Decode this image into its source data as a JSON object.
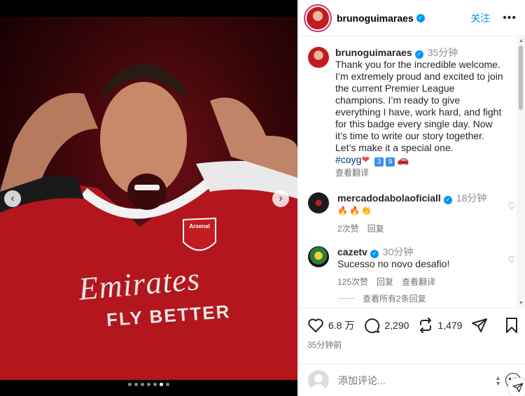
{
  "media": {
    "prev_icon": "chevron-left-icon",
    "next_icon": "chevron-right-icon",
    "slide_count": 7,
    "active_slide": 5,
    "jersey_brand": "Arsenal",
    "sponsor_line1": "Emirates",
    "sponsor_line2": "FLY BETTER"
  },
  "header": {
    "username": "brunoguimaraes",
    "follow_label": "关注",
    "more_icon": "more-horizontal-icon"
  },
  "caption": {
    "username": "brunoguimaraes",
    "time": "35分钟",
    "text": "Thank you for the incredible welcome. I’m extremely proud and excited to join the current Premier League champions. I’m ready to give everything I have, work hard, and fight for this badge every single day. Now it’s time to write our story together. Let’s make it a special one.",
    "hashtag": "#coyg",
    "heart": "❤",
    "key3": "3",
    "key9": "9",
    "car": "🚗",
    "translate_label": "查看翻译"
  },
  "comments": [
    {
      "username": "mercadodabolaoficiall",
      "time": "18分钟",
      "text": "🔥🔥👏",
      "likes": "2次赞",
      "reply": "回复",
      "translate": ""
    },
    {
      "username": "cazetv",
      "time": "30分钟",
      "text": "Sucesso no novo desafio!",
      "likes": "125次赞",
      "reply": "回复",
      "translate": "查看翻译"
    }
  ],
  "view_replies": "查看所有2条回复",
  "actions": {
    "likes": "6.8 万",
    "comments": "2,290",
    "reposts": "1,479",
    "posted_time": "35分钟前"
  },
  "add_comment": {
    "placeholder": "添加评论..."
  },
  "colors": {
    "accent": "#0095f6",
    "jersey_red": "#c21b22"
  }
}
